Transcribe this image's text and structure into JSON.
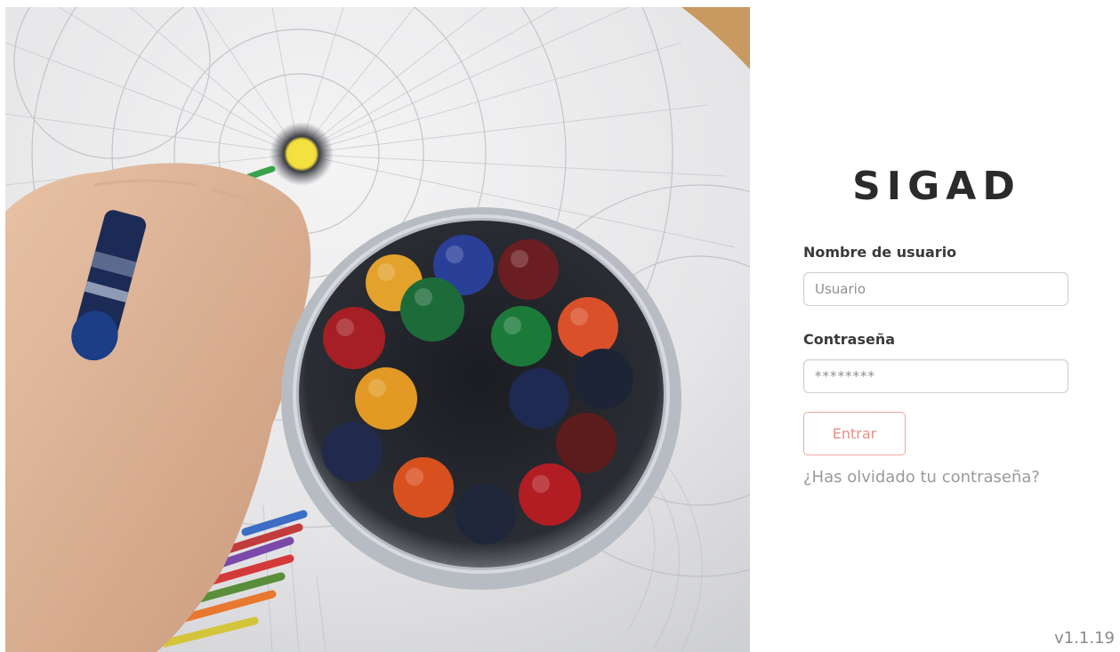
{
  "hero": {
    "image_name": "crayons-jar-photo"
  },
  "login": {
    "brand": "SIGAD",
    "username_label": "Nombre de usuario",
    "username_placeholder": "Usuario",
    "password_label": "Contraseña",
    "password_placeholder": "********",
    "submit_label": "Entrar",
    "forgot_link": "¿Has olvidado tu contraseña?"
  },
  "footer": {
    "version": "v1.1.19"
  },
  "colors": {
    "accent": "#ea8d87",
    "accent_border": "#f0a7a3",
    "brand_text": "#2b2b2b",
    "muted_text": "#9a9a9a"
  }
}
